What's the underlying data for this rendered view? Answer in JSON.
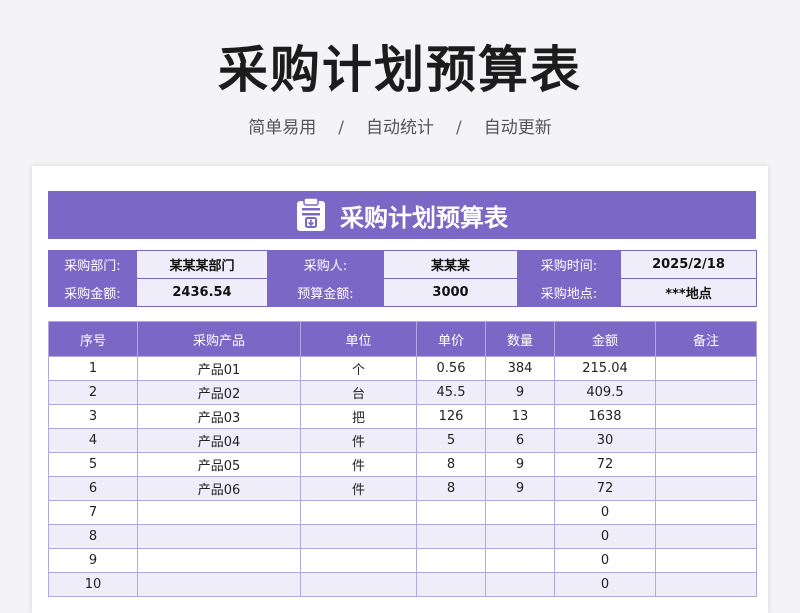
{
  "page": {
    "title": "采购计划预算表",
    "subtitle": [
      "简单易用",
      "自动统计",
      "自动更新"
    ],
    "subtitle_sep": "/"
  },
  "sheet": {
    "banner_title": "采购计划预算表",
    "banner_icon": "clipboard-icon",
    "accent_color": "#7b68c6",
    "stripe_color": "#efedf9",
    "info": {
      "dept_label": "采购部门:",
      "dept_value": "某某某部门",
      "buyer_label": "采购人:",
      "buyer_value": "某某某",
      "time_label": "采购时间:",
      "time_value": "2025/2/18",
      "amount_label": "采购金额:",
      "amount_value": "2436.54",
      "budget_label": "预算金额:",
      "budget_value": "3000",
      "place_label": "采购地点:",
      "place_value": "***地点"
    },
    "table": {
      "headers": [
        "序号",
        "采购产品",
        "单位",
        "单价",
        "数量",
        "金额",
        "备注"
      ],
      "rows": [
        [
          "1",
          "产品01",
          "个",
          "0.56",
          "384",
          "215.04",
          ""
        ],
        [
          "2",
          "产品02",
          "台",
          "45.5",
          "9",
          "409.5",
          ""
        ],
        [
          "3",
          "产品03",
          "把",
          "126",
          "13",
          "1638",
          ""
        ],
        [
          "4",
          "产品04",
          "件",
          "5",
          "6",
          "30",
          ""
        ],
        [
          "5",
          "产品05",
          "件",
          "8",
          "9",
          "72",
          ""
        ],
        [
          "6",
          "产品06",
          "件",
          "8",
          "9",
          "72",
          ""
        ],
        [
          "7",
          "",
          "",
          "",
          "",
          "0",
          ""
        ],
        [
          "8",
          "",
          "",
          "",
          "",
          "0",
          ""
        ],
        [
          "9",
          "",
          "",
          "",
          "",
          "0",
          ""
        ],
        [
          "10",
          "",
          "",
          "",
          "",
          "0",
          ""
        ]
      ]
    }
  }
}
